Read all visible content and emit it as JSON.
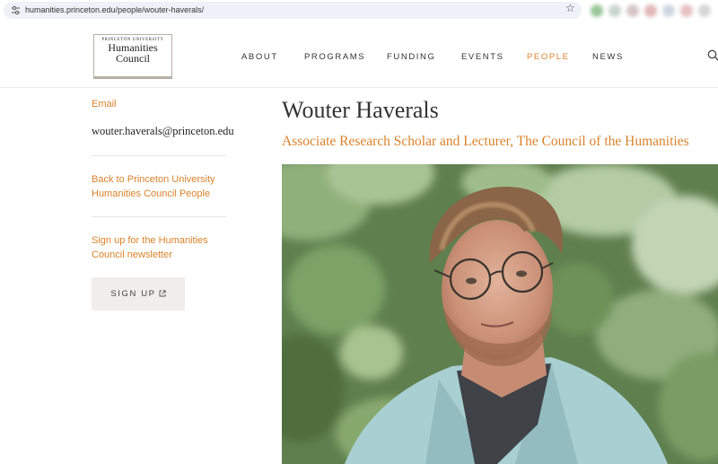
{
  "browser": {
    "url": "humanities.princeton.edu/people/wouter-haverals/",
    "icons": [
      "tune-icon",
      "star-icon"
    ]
  },
  "header": {
    "logo_small": "PRINCETON UNIVERSITY",
    "logo_line1": "Humanities",
    "logo_line2": "Council",
    "nav": [
      {
        "label": "ABOUT"
      },
      {
        "label": "PROGRAMS"
      },
      {
        "label": "FUNDING"
      },
      {
        "label": "EVENTS"
      },
      {
        "label": "PEOPLE",
        "active": true
      },
      {
        "label": "NEWS"
      }
    ]
  },
  "sidebar": {
    "email_label": "Email",
    "email": "wouter.haverals@princeton.edu",
    "back_link": "Back to Princeton University Humanities Council People",
    "newsletter_link": "Sign up for the Humanities Council newsletter",
    "signup_label": "SIGN UP"
  },
  "profile": {
    "name": "Wouter Haverals",
    "title": "Associate Research Scholar and Lecturer, The Council of the Humanities"
  },
  "colors": {
    "accent": "#d9822b",
    "button_bg": "#f0eeec"
  }
}
